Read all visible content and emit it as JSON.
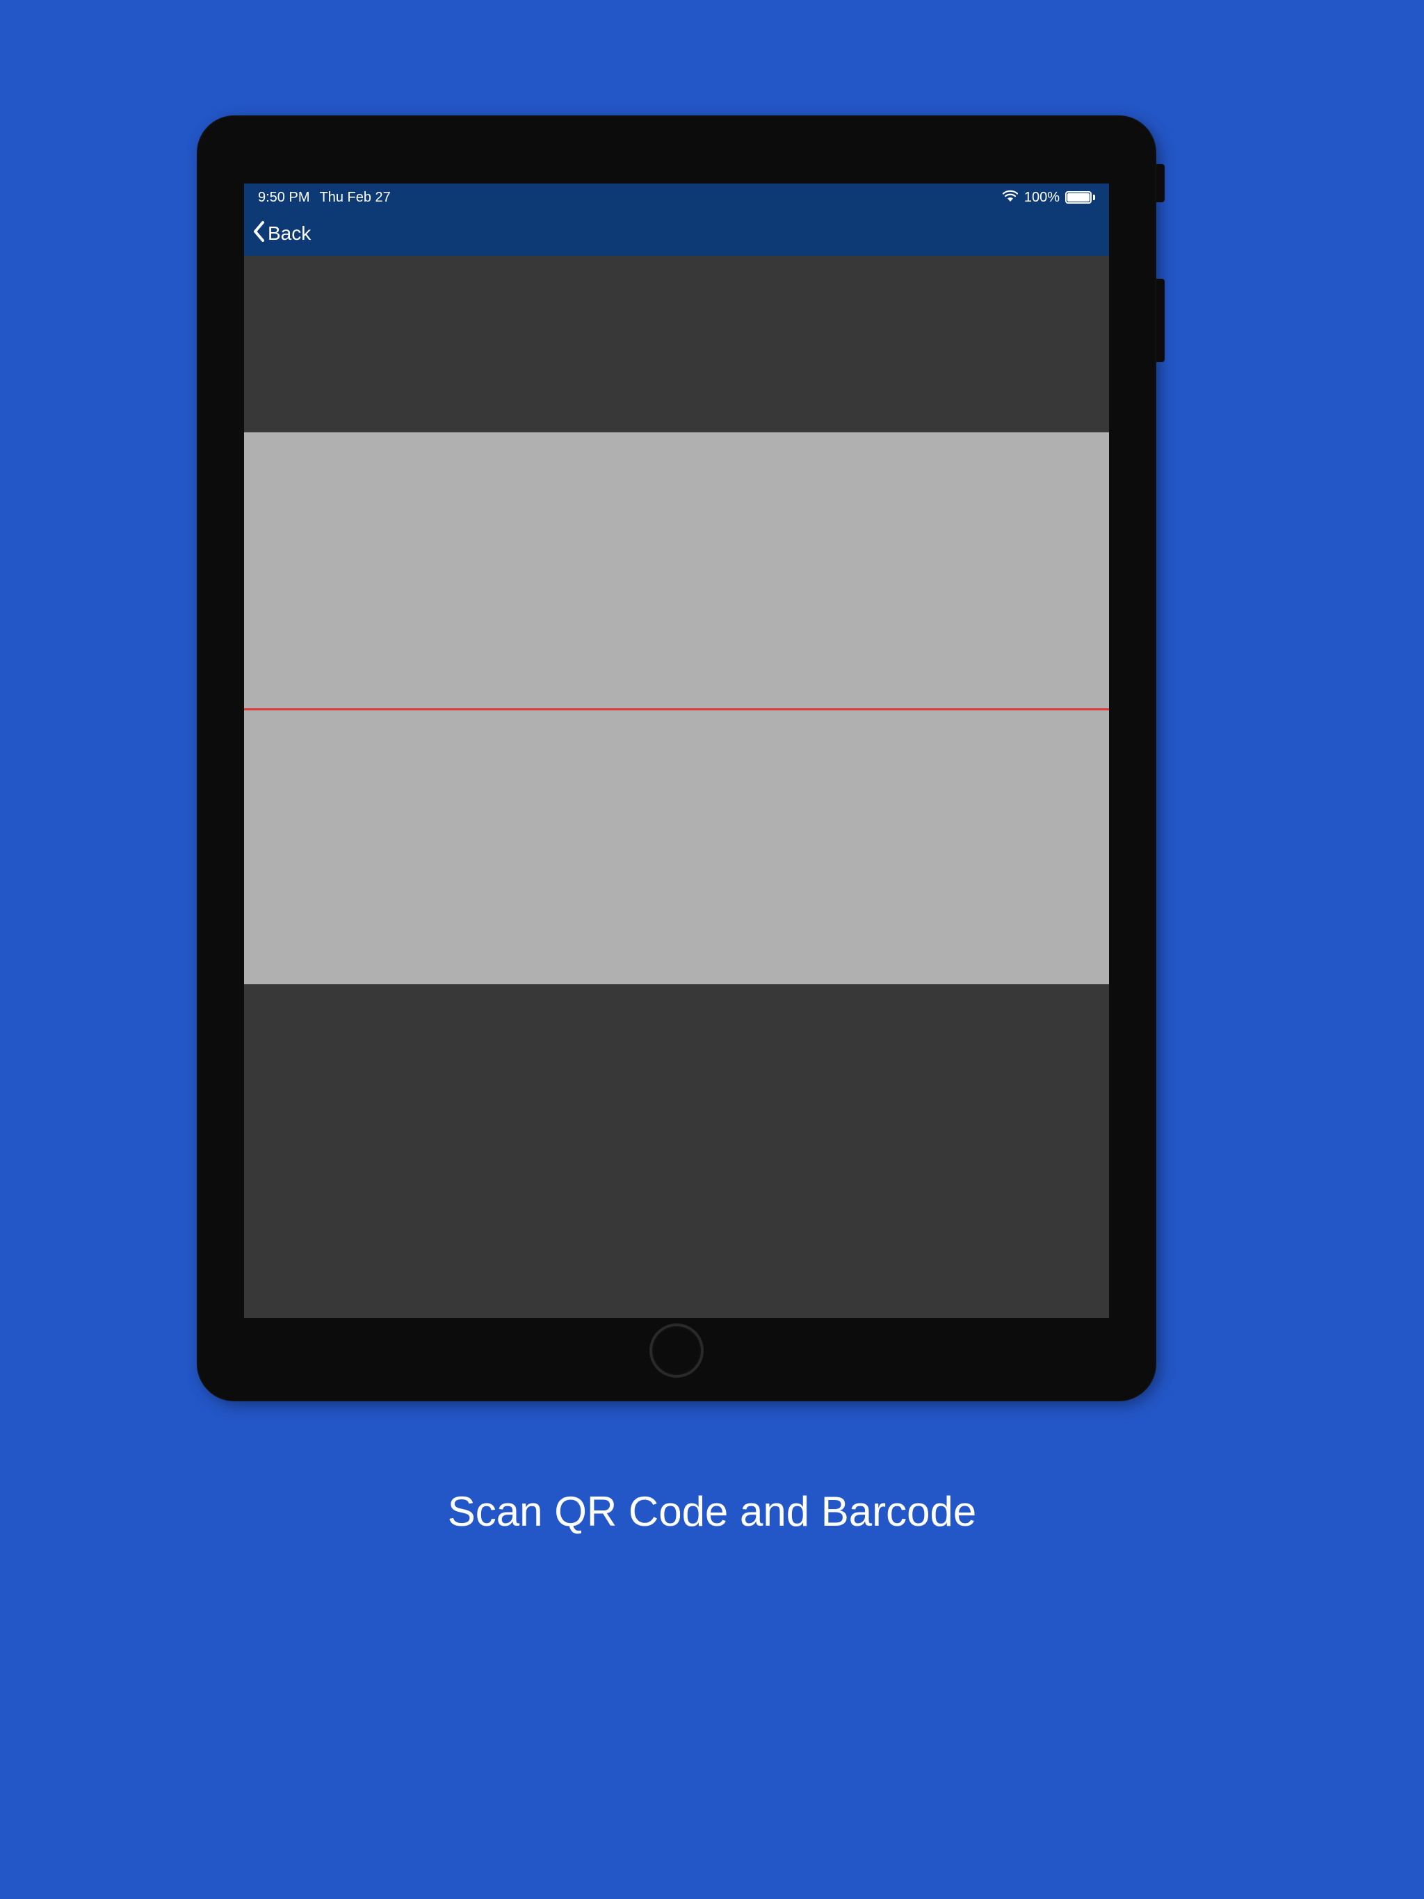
{
  "status": {
    "time": "9:50 PM",
    "date": "Thu Feb 27",
    "battery_percent": "100%"
  },
  "nav": {
    "back_label": "Back"
  },
  "caption": "Scan QR Code and Barcode"
}
